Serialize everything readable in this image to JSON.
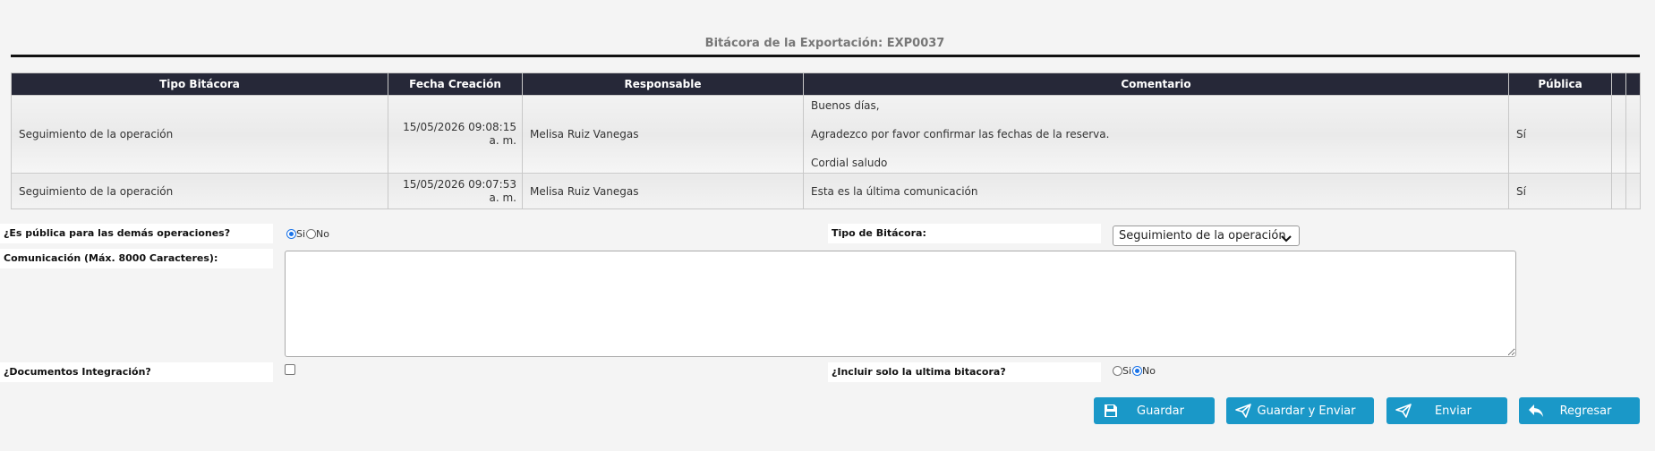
{
  "page": {
    "title": "Bitácora de la Exportación: EXP0037"
  },
  "table": {
    "headers": [
      "Tipo Bitácora",
      "Fecha Creación",
      "Responsable",
      "Comentario",
      "Pública",
      "",
      ""
    ],
    "rows": [
      {
        "tipo": "Seguimiento de la operación",
        "fecha": "15/05/2026 09:08:15 a. m.",
        "responsable": "Melisa Ruiz Vanegas",
        "comentario": [
          "Buenos días,",
          "Agradezco por favor confirmar las fechas de la reserva.",
          "Cordial saludo"
        ],
        "publica": "Sí"
      },
      {
        "tipo": "Seguimiento de la operación",
        "fecha": "15/05/2026 09:07:53 a. m.",
        "responsable": "Melisa Ruiz Vanegas",
        "comentario": [
          "Esta es la última comunicación"
        ],
        "publica": "Sí"
      }
    ]
  },
  "form": {
    "publica_label": "¿Es pública para las demás operaciones?",
    "publica_options": [
      "Si",
      "No"
    ],
    "publica_selected": "Si",
    "tipo_label": "Tipo de Bitácora:",
    "tipo_value": "Seguimiento de la operación",
    "comunicacion_label": "Comunicación (Máx. 8000 Caracteres):",
    "comunicacion_value": "",
    "documentos_label": "¿Documentos Integración?",
    "documentos_checked": false,
    "incluir_label": "¿Incluir solo la ultima bitacora?",
    "incluir_options": [
      "Si",
      "No"
    ],
    "incluir_selected": "No"
  },
  "buttons": {
    "guardar": "Guardar",
    "guardar_enviar": "Guardar y Enviar",
    "enviar": "Enviar",
    "regresar": "Regresar"
  },
  "icons": {
    "guardar": "floppy-disk-icon",
    "guardar_enviar": "paper-plane-icon",
    "enviar": "paper-plane-icon",
    "regresar": "reply-arrow-icon"
  },
  "colors": {
    "header_bg": "#262838",
    "button_bg": "#1a98c8",
    "radio_selected": "#1a73e8"
  }
}
